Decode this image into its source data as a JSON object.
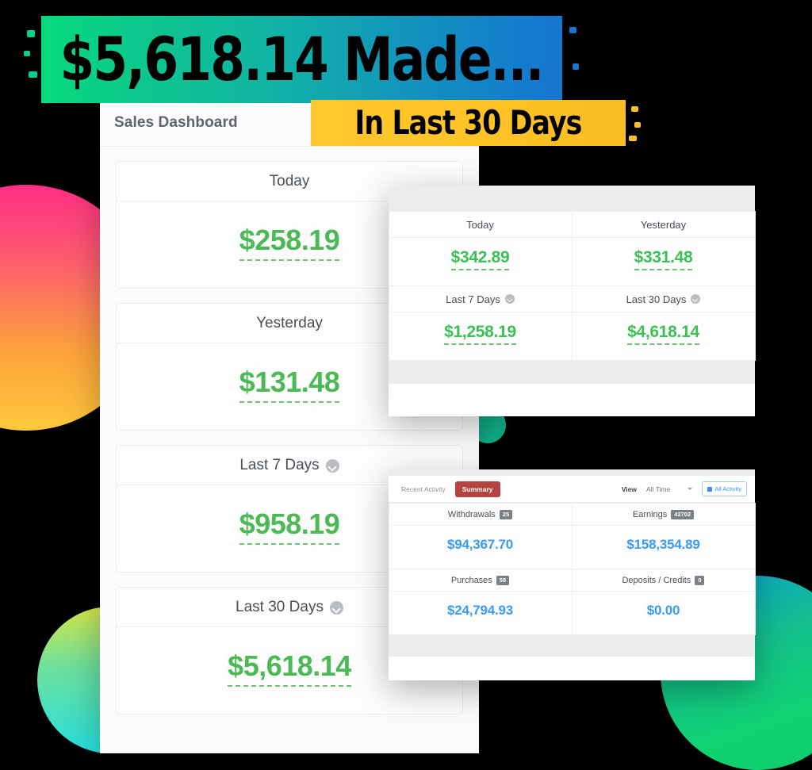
{
  "headline": {
    "main_text": "$5,618.14 Made...",
    "sub_text": "In Last 30 Days",
    "main_gradient_from": "#07d97f",
    "main_gradient_to": "#1576d2",
    "sub_color": "#ffc82e"
  },
  "main_panel": {
    "title": "Sales Dashboard",
    "stats": [
      {
        "label": "Today",
        "value": "$258.19",
        "has_info_icon": false
      },
      {
        "label": "Yesterday",
        "value": "$131.48",
        "has_info_icon": false
      },
      {
        "label": "Last 7 Days",
        "value": "$958.19",
        "has_info_icon": true
      },
      {
        "label": "Last 30 Days",
        "value": "$5,618.14",
        "has_info_icon": true
      }
    ],
    "value_color": "#4cba54"
  },
  "earnings_panel": {
    "cells": [
      {
        "label": "Today",
        "value": "$342.89",
        "has_info_icon": false
      },
      {
        "label": "Yesterday",
        "value": "$331.48",
        "has_info_icon": false
      },
      {
        "label": "Last 7 Days",
        "value": "$1,258.19",
        "has_info_icon": true
      },
      {
        "label": "Last 30 Days",
        "value": "$4,618.14",
        "has_info_icon": true
      }
    ],
    "value_color": "#3cc056"
  },
  "activity_panel": {
    "tabs": [
      {
        "label": "Recent Activity",
        "active": false
      },
      {
        "label": "Summary",
        "active": true
      }
    ],
    "active_tab_color": "#b5433f",
    "view_label": "View",
    "view_selected": "All Time",
    "all_activity_button": "All Activity",
    "all_activity_color": "#3a8ff0",
    "cells": [
      {
        "label": "Withdrawals",
        "badge": "25",
        "value": "$94,367.70"
      },
      {
        "label": "Earnings",
        "badge": "42702",
        "value": "$158,354.89"
      },
      {
        "label": "Purchases",
        "badge": "58",
        "value": "$24,794.93"
      },
      {
        "label": "Deposits / Credits",
        "badge": "0",
        "value": "$0.00"
      }
    ],
    "value_color": "#3a9bf5"
  },
  "decorations": {
    "blob_pink": "#ff2e86",
    "blob_orange": "#ffc93c",
    "blob_teal_small": "#25e0e0",
    "blob_green_large": "#11d372",
    "blob_teal_tiny": "#17c49a"
  }
}
